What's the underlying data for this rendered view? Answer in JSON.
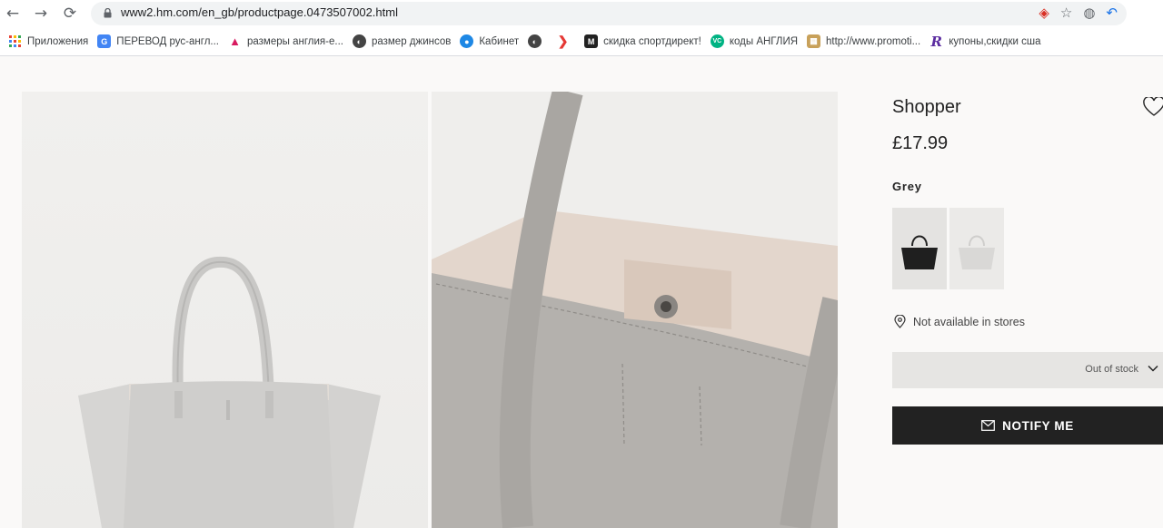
{
  "browser": {
    "url": "www2.hm.com/en_gb/productpage.0473507002.html",
    "bookmarks": [
      {
        "label": "Приложения",
        "icon": "apps-grid-icon",
        "color": "#ea4335"
      },
      {
        "label": "ПЕРЕВОД рус-англ...",
        "icon": "translate-icon",
        "color": "#4285f4"
      },
      {
        "label": "размеры англия-е...",
        "icon": "shoe-icon",
        "color": "#d81b60"
      },
      {
        "label": "размер джинсов",
        "icon": "globe-icon",
        "color": "#444444"
      },
      {
        "label": "Кабинет",
        "icon": "eye-icon",
        "color": "#1e88e5"
      },
      {
        "label": "",
        "icon": "globe-icon",
        "color": "#444444"
      },
      {
        "label": "",
        "icon": "arrow-icon",
        "color": "#e53935"
      },
      {
        "label": "скидка спортдирект!",
        "icon": "m-logo-icon",
        "color": "#222222"
      },
      {
        "label": "коды АНГЛИЯ",
        "icon": "vc-icon",
        "color": "#00b383"
      },
      {
        "label": "http://www.promoti...",
        "icon": "bag-icon",
        "color": "#c8a15a"
      },
      {
        "label": "купоны,скидки сша",
        "icon": "r-logo-icon",
        "color": "#5b2ca0"
      }
    ]
  },
  "product": {
    "title": "Shopper",
    "price": "£17.99",
    "color_name": "Grey",
    "store_availability": "Not available in stores",
    "size_select": "Out of stock",
    "notify_label": "NOTIFY ME"
  }
}
